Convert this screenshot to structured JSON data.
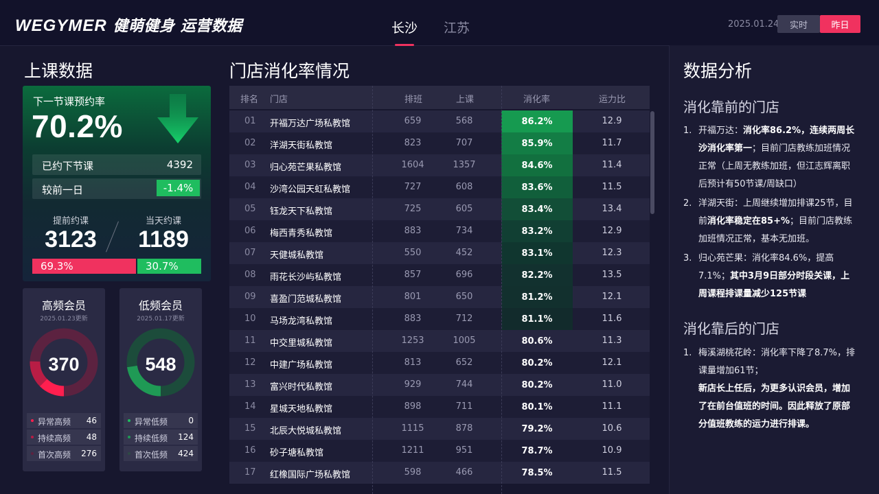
{
  "header": {
    "logo_brand": "WEGYMER",
    "logo_cn": "健萌健身 运营数据",
    "cities": [
      "长沙",
      "江苏"
    ],
    "active_city": "长沙",
    "date": "2025.01.24",
    "btn_realtime": "实时",
    "btn_yesterday": "昨日"
  },
  "left": {
    "title": "上课数据",
    "booking": {
      "label": "下一节课预约率",
      "rate": "70.2%",
      "booked_label": "已约下节课",
      "booked_value": "4392",
      "compare_label": "较前一日",
      "compare_value": "-1.4%",
      "advance_label": "提前约课",
      "advance_value": "3123",
      "sameday_label": "当天约课",
      "sameday_value": "1189",
      "advance_pct": "69.3%",
      "sameday_pct": "30.7%"
    },
    "high_freq": {
      "title": "高频会员",
      "updated": "2025.01.23更新",
      "total": "370",
      "items": [
        {
          "label": "异常高频",
          "value": "46"
        },
        {
          "label": "持续高频",
          "value": "48"
        },
        {
          "label": "首次高频",
          "value": "276"
        }
      ]
    },
    "low_freq": {
      "title": "低频会员",
      "updated": "2025.01.17更新",
      "total": "548",
      "items": [
        {
          "label": "异常低频",
          "value": "0"
        },
        {
          "label": "持续低频",
          "value": "124"
        },
        {
          "label": "首次低频",
          "value": "424"
        }
      ]
    }
  },
  "table": {
    "title": "门店消化率情况",
    "headers": [
      "排名",
      "门店",
      "排班",
      "上课",
      "消化率",
      "运力比"
    ],
    "rows": [
      {
        "rank": "01",
        "name": "开福万达广场私教馆",
        "pb": "659",
        "sk": "568",
        "rate": "86.2%",
        "yl": "12.9"
      },
      {
        "rank": "02",
        "name": "洋湖天街私教馆",
        "pb": "823",
        "sk": "707",
        "rate": "85.9%",
        "yl": "11.7"
      },
      {
        "rank": "03",
        "name": "归心苑芒果私教馆",
        "pb": "1604",
        "sk": "1357",
        "rate": "84.6%",
        "yl": "11.4"
      },
      {
        "rank": "04",
        "name": "沙湾公园天虹私教馆",
        "pb": "727",
        "sk": "608",
        "rate": "83.6%",
        "yl": "11.5"
      },
      {
        "rank": "05",
        "name": "钰龙天下私教馆",
        "pb": "725",
        "sk": "605",
        "rate": "83.4%",
        "yl": "13.4"
      },
      {
        "rank": "06",
        "name": "梅西青秀私教馆",
        "pb": "883",
        "sk": "734",
        "rate": "83.2%",
        "yl": "12.9"
      },
      {
        "rank": "07",
        "name": "天健城私教馆",
        "pb": "550",
        "sk": "452",
        "rate": "83.1%",
        "yl": "12.3"
      },
      {
        "rank": "08",
        "name": "雨花长沙屿私教馆",
        "pb": "857",
        "sk": "696",
        "rate": "82.2%",
        "yl": "13.5"
      },
      {
        "rank": "09",
        "name": "喜盈门范城私教馆",
        "pb": "801",
        "sk": "650",
        "rate": "81.2%",
        "yl": "12.1"
      },
      {
        "rank": "10",
        "name": "马场龙湾私教馆",
        "pb": "883",
        "sk": "712",
        "rate": "81.1%",
        "yl": "11.6"
      },
      {
        "rank": "11",
        "name": "中交里城私教馆",
        "pb": "1253",
        "sk": "1005",
        "rate": "80.6%",
        "yl": "11.3"
      },
      {
        "rank": "12",
        "name": "中建广场私教馆",
        "pb": "813",
        "sk": "652",
        "rate": "80.2%",
        "yl": "12.1"
      },
      {
        "rank": "13",
        "name": "富兴时代私教馆",
        "pb": "929",
        "sk": "744",
        "rate": "80.2%",
        "yl": "11.0"
      },
      {
        "rank": "14",
        "name": "星城天地私教馆",
        "pb": "898",
        "sk": "711",
        "rate": "80.1%",
        "yl": "11.1"
      },
      {
        "rank": "15",
        "name": "北辰大悦城私教馆",
        "pb": "1115",
        "sk": "878",
        "rate": "79.2%",
        "yl": "10.6"
      },
      {
        "rank": "16",
        "name": "砂子塘私教馆",
        "pb": "1211",
        "sk": "951",
        "rate": "78.7%",
        "yl": "10.9"
      },
      {
        "rank": "17",
        "name": "红橡国际广场私教馆",
        "pb": "598",
        "sk": "466",
        "rate": "78.5%",
        "yl": "11.5"
      }
    ]
  },
  "analysis": {
    "title": "数据分析",
    "front_title": "消化靠前的门店",
    "back_title": "消化靠后的门店",
    "front_notes": [
      {
        "num": "1.",
        "html": "开福万达：<b>消化率86.2%，连续两周长沙消化率第一</b>；目前门店教练加班情况正常（上周无教练加班，但江志辉离职后预计有50节课/周缺口）"
      },
      {
        "num": "2.",
        "html": "洋湖天街：上周继续增加排课25节，目前<b>消化率稳定在85+%</b>；目前门店教练加班情况正常，基本无加班。"
      },
      {
        "num": "3.",
        "html": "归心苑芒果：消化率84.6%，提高7.1%；<b>其中3月9日部分时段关课，上周课程排课量减少125节课</b>"
      }
    ],
    "back_notes": [
      {
        "num": "1.",
        "html": "梅溪湖桃花岭：消化率下降了8.7%，排课量增加61节；<br><b>新店长上任后，为更多认识会员，增加了在前台值班的时间。因此释放了原部分值班教练的运力进行排课。</b>"
      }
    ]
  },
  "colors": {
    "accent": "#f0325f",
    "green": "#1fbd5f",
    "high_ring": "#e8244f",
    "low_ring": "#1f9a55"
  }
}
